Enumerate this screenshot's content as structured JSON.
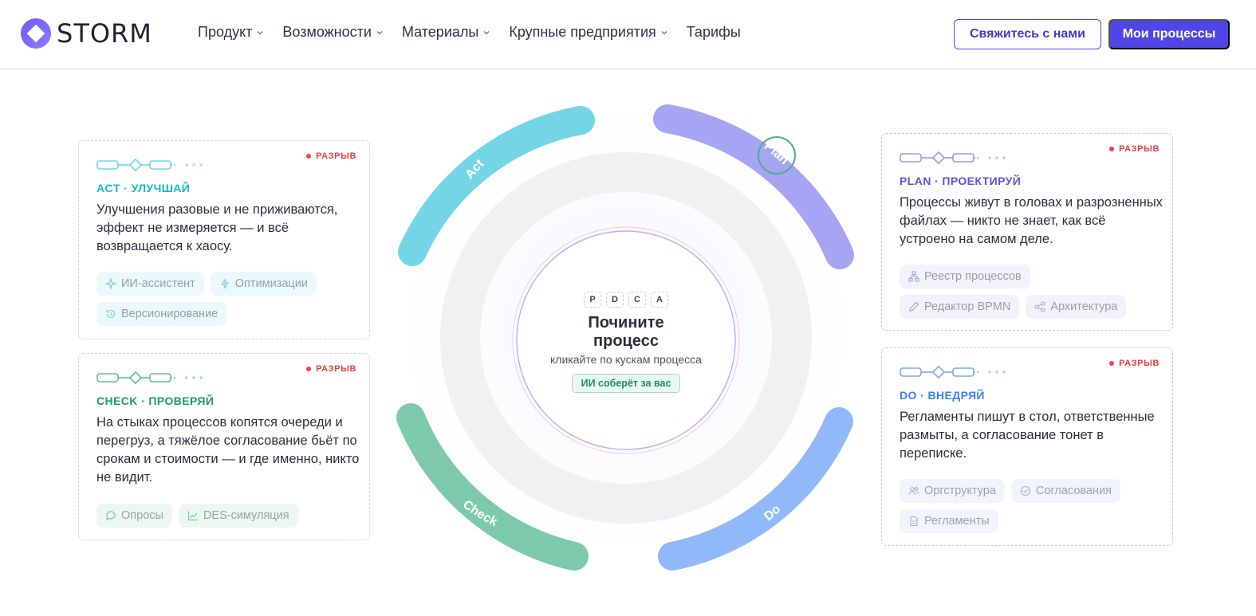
{
  "header": {
    "logo_text": "STORM",
    "nav": [
      {
        "label": "Продукт",
        "has_dropdown": true
      },
      {
        "label": "Возможности",
        "has_dropdown": true
      },
      {
        "label": "Материалы",
        "has_dropdown": true
      },
      {
        "label": "Крупные предприятия",
        "has_dropdown": true
      },
      {
        "label": "Тарифы",
        "has_dropdown": false
      }
    ],
    "contact_button": "Свяжитесь с нами",
    "processes_button": "Мои процессы"
  },
  "cycle": {
    "segments": [
      {
        "label": "Act",
        "color": "#74d5e6"
      },
      {
        "label": "Plan",
        "color": "#a6a5f3"
      },
      {
        "label": "Check",
        "color": "#7ccaab"
      },
      {
        "label": "Do",
        "color": "#91b8f8"
      }
    ],
    "center": {
      "pdca": [
        "P",
        "D",
        "C",
        "A"
      ],
      "title_line1": "Почините",
      "title_line2": "процесс",
      "subtitle": "кликайте по кускам процесса",
      "ai_badge": "ИИ соберёт за вас"
    }
  },
  "cards": {
    "act": {
      "badge": "РАЗРЫВ",
      "tag": "ACT · УЛУЧШАЙ",
      "text": "Улучшения разовые и не приживаются, эффект не измеряется — и всё возвращается к хаосу.",
      "chips": [
        {
          "label": "ИИ-ассистент",
          "icon": "sparkle-icon"
        },
        {
          "label": "Оптимизации",
          "icon": "bolt-icon"
        },
        {
          "label": "Версионирование",
          "icon": "history-icon"
        }
      ]
    },
    "check": {
      "badge": "РАЗРЫВ",
      "tag": "CHECK · ПРОВЕРЯЙ",
      "text": "На стыках процессов копятся очереди и перегруз, а тяжёлое согласование бьёт по срокам и стоимости — и где именно, никто не видит.",
      "chips": [
        {
          "label": "Опросы",
          "icon": "chat-icon"
        },
        {
          "label": "DES-симуляция",
          "icon": "chart-icon"
        }
      ]
    },
    "plan": {
      "badge": "РАЗРЫВ",
      "tag": "PLAN · ПРОЕКТИРУЙ",
      "text": "Процессы живут в головах и разрозненных файлах — никто не знает, как всё устроено на самом деле.",
      "chips": [
        {
          "label": "Реестр процессов",
          "icon": "hierarchy-icon"
        },
        {
          "label": "Редактор BPMN",
          "icon": "pencil-icon"
        },
        {
          "label": "Архитектура",
          "icon": "share-icon"
        }
      ]
    },
    "do": {
      "badge": "РАЗРЫВ",
      "tag": "DO · ВНЕДРЯЙ",
      "text": "Регламенты пишут в стол, ответственные размыты, а согласование тонет в переписке.",
      "chips": [
        {
          "label": "Оргструктура",
          "icon": "users-icon"
        },
        {
          "label": "Согласования",
          "icon": "check-circle-icon"
        },
        {
          "label": "Регламенты",
          "icon": "document-icon"
        }
      ]
    }
  }
}
